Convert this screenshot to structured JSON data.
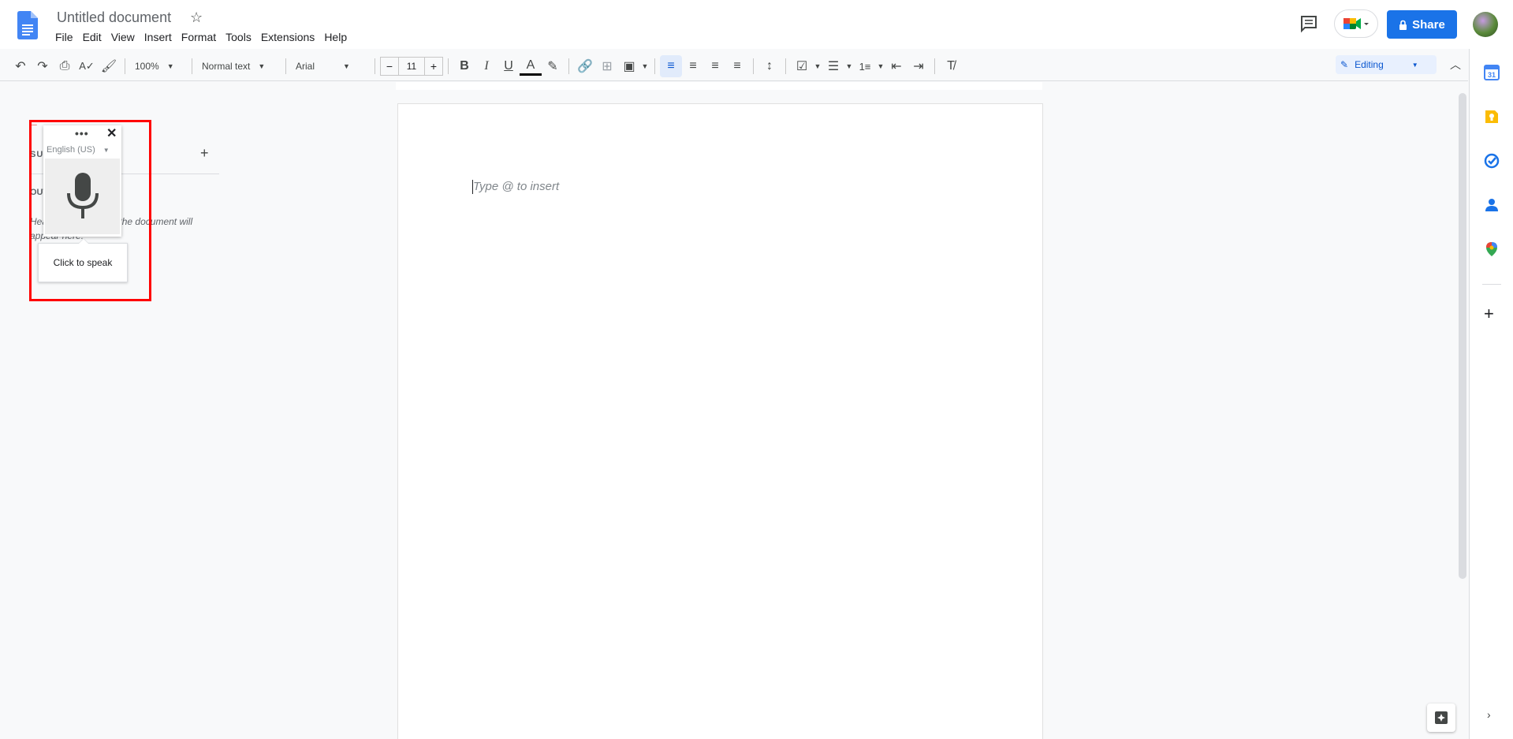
{
  "document": {
    "title": "Untitled document",
    "placeholder": "Type @ to insert"
  },
  "menu": [
    "File",
    "Edit",
    "View",
    "Insert",
    "Format",
    "Tools",
    "Extensions",
    "Help"
  ],
  "header": {
    "share_label": "Share"
  },
  "toolbar": {
    "zoom": "100%",
    "style": "Normal text",
    "font": "Arial",
    "font_size": "11",
    "mode": "Editing"
  },
  "outline": {
    "heading": "SUMMARY",
    "sub_heading": "OUTLINE",
    "hint": "Headings you add to the document will appear here."
  },
  "voice_typing": {
    "language": "English (US)",
    "tooltip": "Click to speak"
  },
  "colors": {
    "accent": "#1a73e8",
    "highlight_box": "#ff0000"
  }
}
